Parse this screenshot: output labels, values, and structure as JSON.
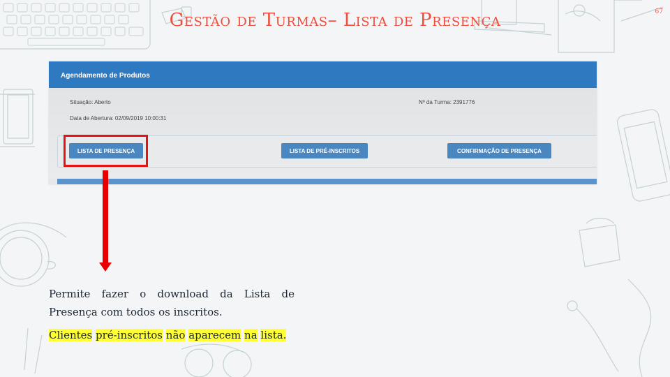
{
  "slide": {
    "title": "Gestão de Turmas– Lista de Presença",
    "page_number": "67"
  },
  "screenshot": {
    "header_title": "Agendamento de Produtos",
    "fields": {
      "situacao": "Situação: Aberto",
      "numero_turma": "Nº da Turma: 2391776",
      "data_abertura": "Data de Abertura: 02/09/2019 10:00:31"
    },
    "buttons": {
      "lista_presenca": "LISTA DE PRESENÇA",
      "lista_pre_inscritos": "LISTA DE PRÉ-INSCRITOS",
      "confirmacao_presenca": "CONFIRMAÇÃO DE PRESENÇA"
    }
  },
  "description": "Permite fazer o download da Lista de Presença com todos os inscritos.",
  "note": {
    "w1": "Clientes",
    "w2": "pré-inscritos",
    "w3": "não",
    "w4": "aparecem",
    "w5": "na",
    "w6": "lista."
  },
  "colors": {
    "title": "#f04e3e",
    "header_blue": "#2f79c0",
    "button_blue": "#4a86c0",
    "highlight_red": "#e31414",
    "note_highlight": "#ffff33"
  }
}
